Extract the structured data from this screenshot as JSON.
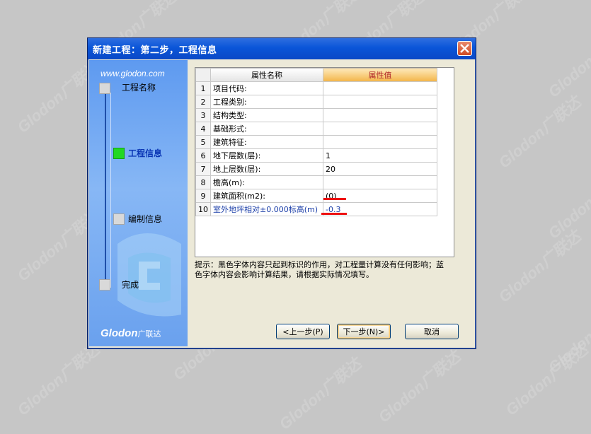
{
  "watermark": "Glodon广联达",
  "dialog": {
    "title": "新建工程：第二步，工程信息"
  },
  "sidebar": {
    "url": "www.glodon.com",
    "brand": "Glodon",
    "brand_cn": "广联达",
    "steps": [
      {
        "label": "工程名称",
        "active": false
      },
      {
        "label": "工程信息",
        "active": true
      },
      {
        "label": "编制信息",
        "active": false
      },
      {
        "label": "完成",
        "active": false
      }
    ]
  },
  "grid": {
    "headers": [
      "属性名称",
      "属性值"
    ],
    "rows": [
      {
        "num": "1",
        "name": "项目代码:",
        "value": ""
      },
      {
        "num": "2",
        "name": "工程类别:",
        "value": ""
      },
      {
        "num": "3",
        "name": "结构类型:",
        "value": ""
      },
      {
        "num": "4",
        "name": "基础形式:",
        "value": ""
      },
      {
        "num": "5",
        "name": "建筑特征:",
        "value": ""
      },
      {
        "num": "6",
        "name": "地下层数(层):",
        "value": "1"
      },
      {
        "num": "7",
        "name": "地上层数(层):",
        "value": "20"
      },
      {
        "num": "8",
        "name": "檐高(m):",
        "value": ""
      },
      {
        "num": "9",
        "name": "建筑面积(m2):",
        "value": "(0)"
      },
      {
        "num": "10",
        "name": "室外地坪相对±0.000标高(m)",
        "value": "-0.3"
      }
    ]
  },
  "hint": "提示：黑色字体内容只起到标识的作用，对工程量计算没有任何影响；蓝色字体内容会影响计算结果，请根据实际情况填写。",
  "buttons": {
    "prev": "<上一步(P)",
    "next": "下一步(N)>",
    "cancel": "取消"
  },
  "colors": {
    "title_bar": "#0a55d8",
    "active_step": "#22d822",
    "highlight_header": "#f3b548",
    "annotation_red": "#ee1111",
    "blue_text": "#1b3ea8"
  }
}
